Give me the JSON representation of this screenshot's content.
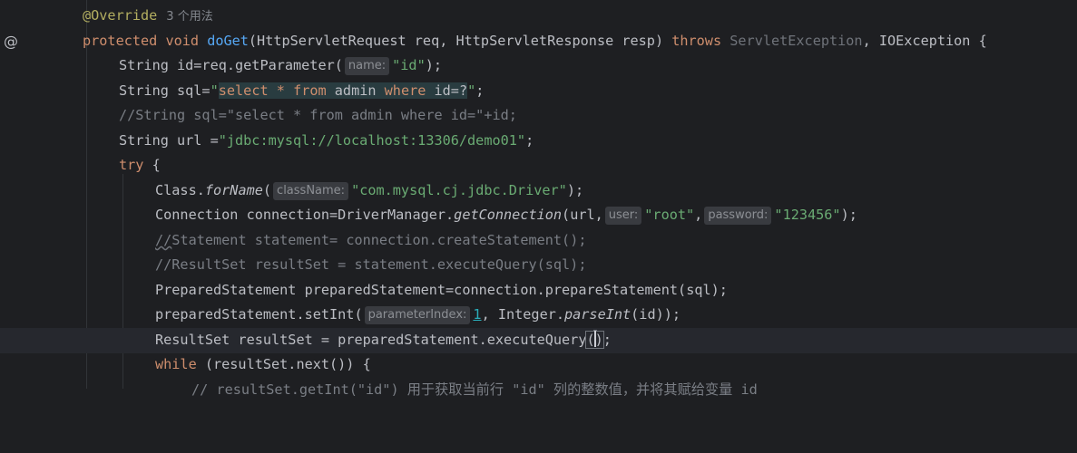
{
  "gutter": {
    "annotation_icon": "@"
  },
  "lines": [
    {
      "annotation": "@Override",
      "usage": "3 个用法"
    },
    {
      "kw1": "protected",
      "kw2": "void",
      "fn": "doGet",
      "p1": "(HttpServletRequest req, HttpServletResponse resp) ",
      "throws": "throws",
      "sp": " ",
      "exc1": "ServletException",
      "rest": ", IOException {"
    },
    {
      "a": "String id=req.getParameter(",
      "hint": "name:",
      "str": "\"id\"",
      "b": ");"
    },
    {
      "a": "String sql=",
      "q1": "\"",
      "s1": "select",
      "s2": " * ",
      "s3": "from",
      "s4": " admin ",
      "s5": "where",
      "s6": " id=?",
      "q2": "\"",
      "b": ";"
    },
    {
      "comment": "//String sql=\"select * from admin where id=\"+id;"
    },
    {
      "a": "String url =",
      "str": "\"jdbc:mysql://localhost:13306/demo01\"",
      "b": ";"
    },
    {
      "kw": "try",
      "b": " {"
    },
    {
      "a": "Class.",
      "m": "forName",
      "p": "(",
      "hint": "className:",
      "str": "\"com.mysql.cj.jdbc.Driver\"",
      "b": ");"
    },
    {
      "a": "Connection connection=DriverManager.",
      "m": "getConnection",
      "p": "(url,",
      "hint1": "user:",
      "str1": "\"root\"",
      "c": ",",
      "hint2": "password:",
      "str2": "\"123456\"",
      "b": ");"
    },
    {
      "c1": "//",
      "c2": "Statement statement= connection.createStatement();"
    },
    {
      "comment": "//ResultSet resultSet = statement.executeQuery(sql);"
    },
    {
      "text": "PreparedStatement preparedStatement=connection.prepareStatement(sql);"
    },
    {
      "a": "preparedStatement.setInt(",
      "hint": "parameterIndex:",
      "num": "1",
      "c": ", Integer.",
      "m": "parseInt",
      "b": "(id));"
    },
    {
      "a": "ResultSet resultSet = preparedStatement.executeQuery",
      "p1": "(",
      "p2": ")",
      "b": ";"
    },
    {
      "kw": "while",
      "b": " (resultSet.next()) {"
    },
    {
      "comment": "// resultSet.getInt(\"id\") 用于获取当前行 \"id\" 列的整数值，并将其赋给变量 id"
    }
  ]
}
